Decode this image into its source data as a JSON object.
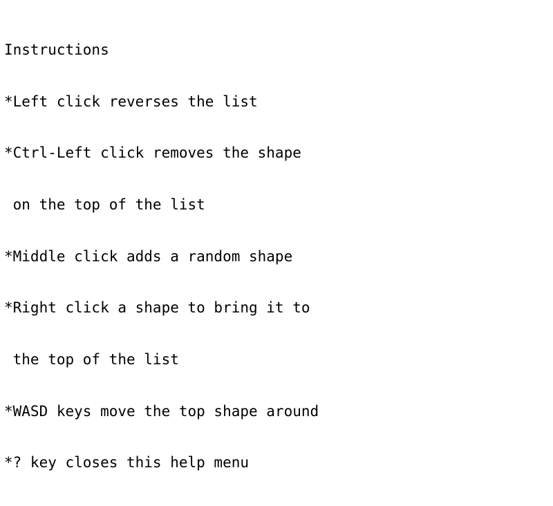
{
  "help": {
    "lines": [
      "Instructions",
      "*Left click reverses the list",
      "*Ctrl-Left click removes the shape",
      " on the top of the list",
      "*Middle click adds a random shape",
      "*Right click a shape to bring it to",
      " the top of the list",
      "*WASD keys move the top shape around",
      "*? key closes this help menu"
    ]
  },
  "colors": {
    "background": "#ffffff",
    "text": "#000000"
  }
}
